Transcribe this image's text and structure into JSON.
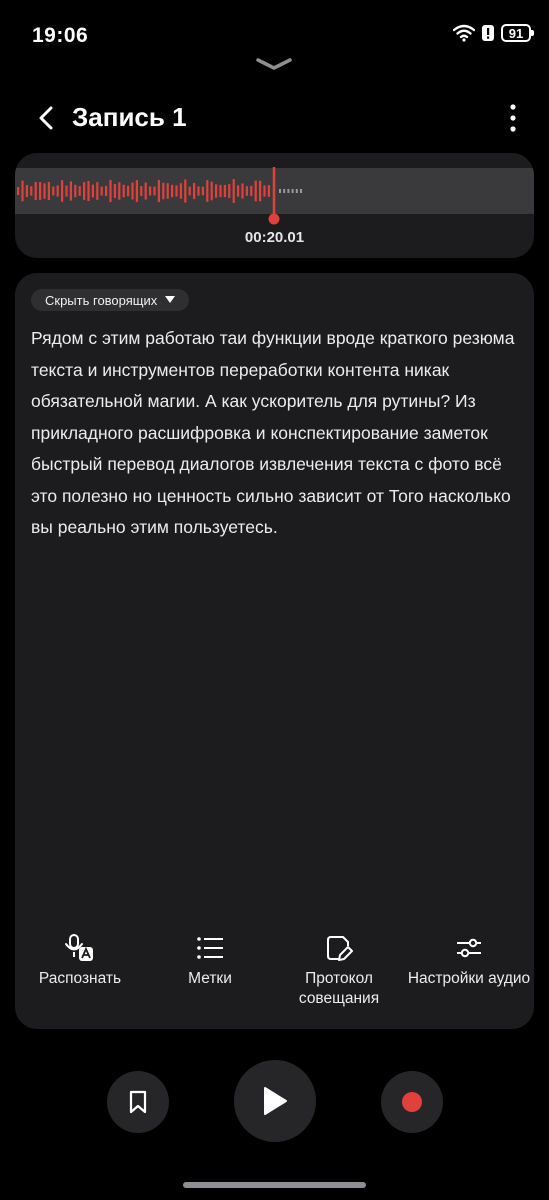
{
  "status": {
    "time": "19:06",
    "battery": "91"
  },
  "header": {
    "title": "Запись 1"
  },
  "player": {
    "current_time": "00:20.01",
    "accent_color": "#e0413a"
  },
  "transcript": {
    "speakers_toggle": "Скрыть говорящих",
    "text": "Рядом с этим работаю таи функции вроде краткого резюма текста и инструментов переработки контента никак обязательной магии. А как ускоритель для рутины? Из прикладного расшифровка и конспектирование заметок быстрый перевод диалогов извлечения текста с фото всё это полезно но ценность сильно зависит от Того насколько вы реально этим пользуетесь."
  },
  "actions": [
    {
      "label": "Распознать",
      "icon": "mic-translate-icon"
    },
    {
      "label": "Метки",
      "icon": "list-icon"
    },
    {
      "label": "Протокол совещания",
      "icon": "note-edit-icon"
    },
    {
      "label": "Настройки аудио",
      "icon": "sliders-icon"
    }
  ],
  "controls": [
    "bookmark-icon",
    "play-icon",
    "record-icon"
  ]
}
